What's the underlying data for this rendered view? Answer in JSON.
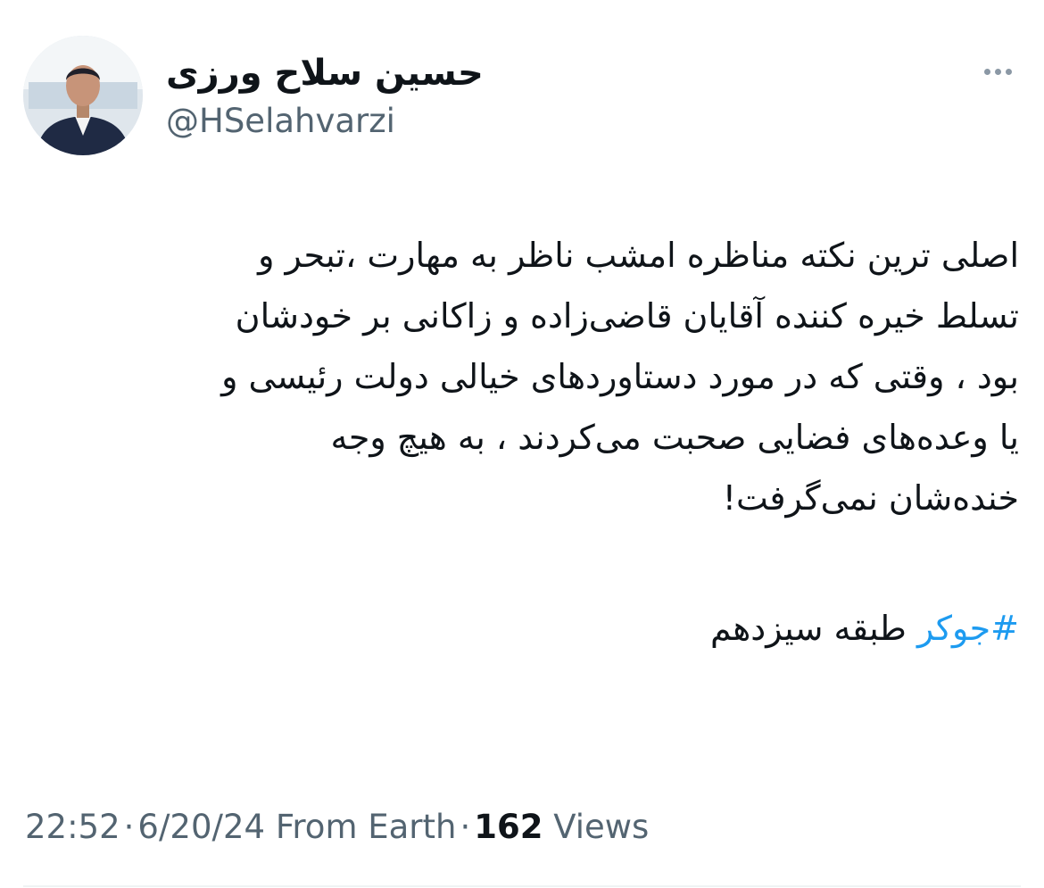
{
  "author": {
    "display_name": "حسین سلاح ورزی",
    "handle": "@HSelahvarzi",
    "avatar_icon": "profile-photo"
  },
  "more_icon": "more-horizontal-icon",
  "tweet": {
    "lines": [
      "اصلی ترین نکته مناظره امشب ناظر به مهارت ،تبحر و",
      "تسلط خیره کننده آقایان قاضی‌زاده و زاکانی بر خودشان",
      "بود ، وقتی که در مورد دستاوردهای خیالی دولت رئیسی و",
      "یا وعده‌های فضایی صحبت می‌کردند ، به هیچ وجه",
      "خنده‌شان نمی‌گرفت!"
    ],
    "hashtag": "#جوکر",
    "hashtag_suffix": "طبقه سیزدهم"
  },
  "meta": {
    "time": "22:52",
    "separator": "·",
    "date": "6/20/24",
    "source": "From Earth",
    "views_count": "162",
    "views_label": "Views"
  },
  "colors": {
    "text": "#0f1419",
    "secondary": "#536471",
    "link": "#1d9bf0"
  }
}
